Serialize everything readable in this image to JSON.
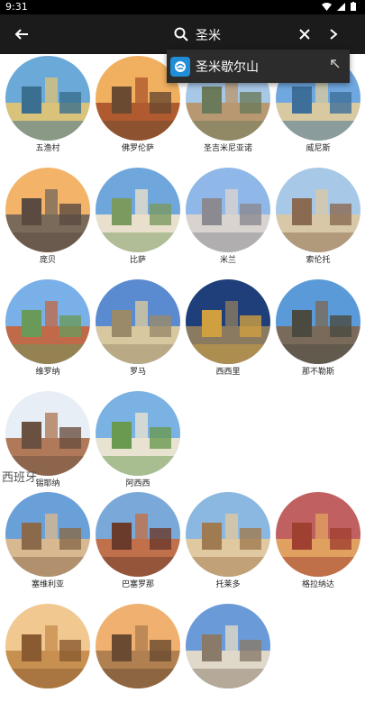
{
  "status": {
    "time": "9:31"
  },
  "search": {
    "query": "圣米"
  },
  "suggestion": {
    "text": "圣米歇尔山"
  },
  "italy_places": [
    "五渔村",
    "佛罗伦萨",
    "圣吉米尼亚诺",
    "威尼斯",
    "庞贝",
    "比萨",
    "米兰",
    "索伦托",
    "维罗纳",
    "罗马",
    "西西里",
    "那不勒斯",
    "锡耶纳",
    "阿西西"
  ],
  "spain_section": {
    "title": "西班牙"
  },
  "spain_places": [
    "塞维利亚",
    "巴塞罗那",
    "托莱多",
    "格拉纳达",
    "",
    "",
    ""
  ],
  "colors": {
    "appbar": "#1b1b1b",
    "suggest_bg": "#2c2c2c",
    "badge": "#1f8ed6"
  },
  "icons": [
    "back-arrow-icon",
    "search-icon",
    "clear-icon",
    "forward-icon",
    "place-badge-icon",
    "arrow-up-left-icon"
  ]
}
